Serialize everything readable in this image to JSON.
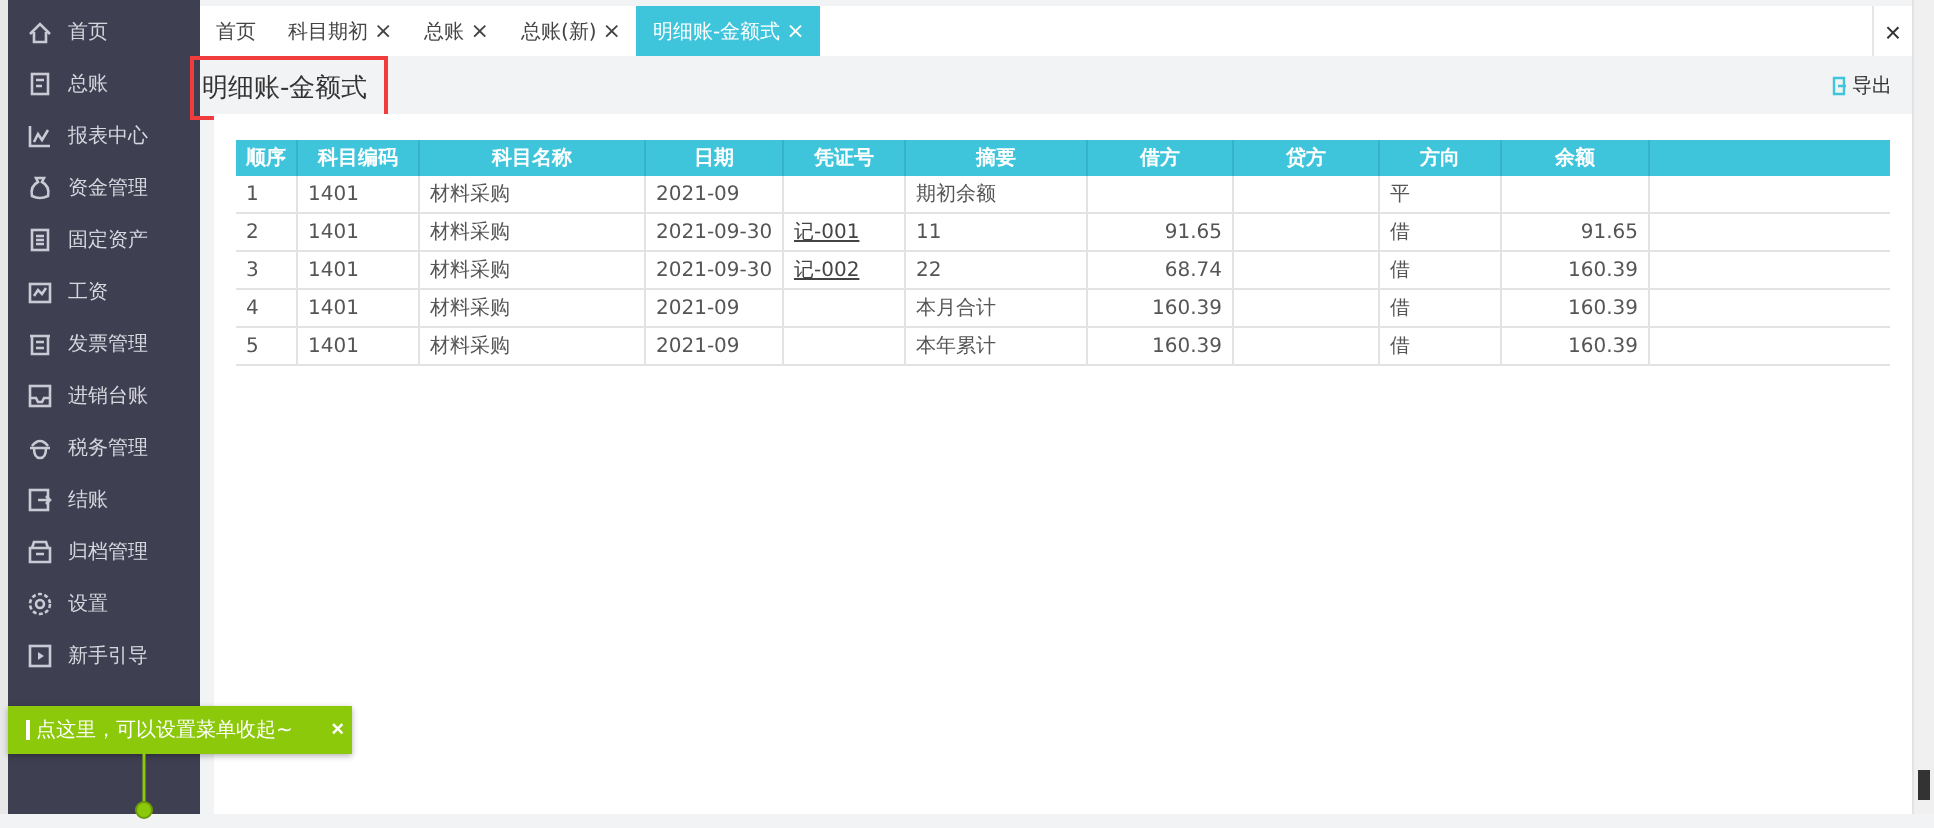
{
  "sidebar": {
    "items": [
      {
        "label": "首页"
      },
      {
        "label": "总账"
      },
      {
        "label": "报表中心"
      },
      {
        "label": "资金管理"
      },
      {
        "label": "固定资产"
      },
      {
        "label": "工资"
      },
      {
        "label": "发票管理"
      },
      {
        "label": "进销台账"
      },
      {
        "label": "税务管理"
      },
      {
        "label": "结账"
      },
      {
        "label": "归档管理"
      },
      {
        "label": "设置"
      },
      {
        "label": "新手引导"
      }
    ]
  },
  "tabs": [
    {
      "label": "首页",
      "selected": false
    },
    {
      "label": "科目期初",
      "close": "×",
      "selected": false
    },
    {
      "label": "总账",
      "close": "×",
      "selected": false
    },
    {
      "label": "总账(新)",
      "close": "×",
      "selected": false
    },
    {
      "label": "明细账-金额式",
      "close": "×",
      "selected": true
    }
  ],
  "tab_close_all": "×",
  "page": {
    "title": "明细账-金额式",
    "export": "导出"
  },
  "table": {
    "columns": [
      "顺序",
      "科目编码",
      "科目名称",
      "日期",
      "凭证号",
      "摘要",
      "借方",
      "贷方",
      "方向",
      "余额"
    ],
    "rows": [
      {
        "seq": "1",
        "code": "1401",
        "name": "材料采购",
        "date": "2021-09",
        "summary": "期初余额",
        "direction": "平"
      },
      {
        "seq": "2",
        "code": "1401",
        "name": "材料采购",
        "date": "2021-09-30",
        "voucher": "记-001",
        "summary": "11",
        "debit": "91.65",
        "direction": "借",
        "balance": "91.65"
      },
      {
        "seq": "3",
        "code": "1401",
        "name": "材料采购",
        "date": "2021-09-30",
        "voucher": "记-002",
        "summary": "22",
        "debit": "68.74",
        "direction": "借",
        "balance": "160.39"
      },
      {
        "seq": "4",
        "code": "1401",
        "name": "材料采购",
        "date": "2021-09",
        "summary": "本月合计",
        "debit": "160.39",
        "direction": "借",
        "balance": "160.39"
      },
      {
        "seq": "5",
        "code": "1401",
        "name": "材料采购",
        "date": "2021-09",
        "summary": "本年累计",
        "debit": "160.39",
        "direction": "借",
        "balance": "160.39"
      }
    ]
  },
  "tooltip": {
    "text": "点这里，可以设置菜单收起~",
    "close": "×"
  }
}
